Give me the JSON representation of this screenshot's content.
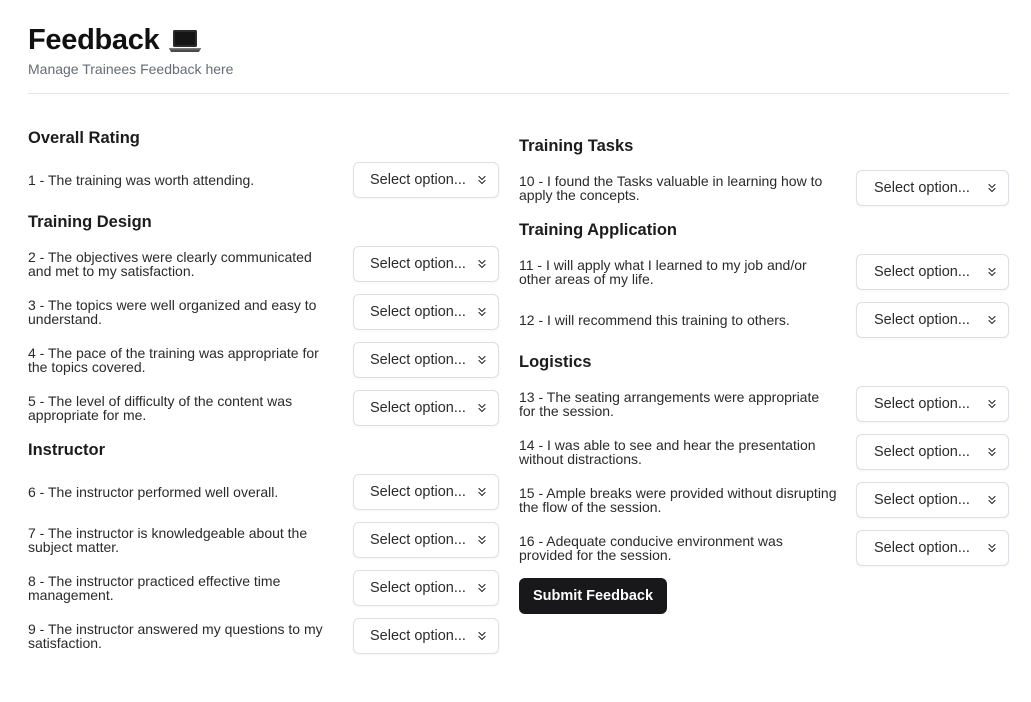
{
  "header": {
    "title": "Feedback",
    "icon": "laptop-icon",
    "subtitle": "Manage Trainees Feedback here"
  },
  "select_placeholder": "Select option...",
  "sections": {
    "overall": {
      "title": "Overall Rating",
      "questions": [
        "1 - The training was worth attending."
      ]
    },
    "design": {
      "title": "Training Design",
      "questions": [
        "2 - The objectives were clearly communicated and met to my satisfaction.",
        "3 - The topics were well organized and easy to understand.",
        "4 - The pace of the training was appropriate for the topics covered.",
        "5 - The level of difficulty of the content was appropriate for me."
      ]
    },
    "instructor": {
      "title": "Instructor",
      "questions": [
        "6 - The instructor performed well overall.",
        "7 - The instructor is knowledgeable about the subject matter.",
        "8 - The instructor practiced effective time management.",
        "9 - The instructor answered my questions to my satisfaction."
      ]
    },
    "tasks": {
      "title": "Training Tasks",
      "questions": [
        "10 - I found the Tasks valuable in learning how to apply the concepts."
      ]
    },
    "application": {
      "title": "Training Application",
      "questions": [
        "11 - I will apply what I learned to my job and/or other areas of my life.",
        "12 - I will recommend this training to others."
      ]
    },
    "logistics": {
      "title": "Logistics",
      "questions": [
        "13 - The seating arrangements were appropriate for the session.",
        "14 - I was able to see and hear the presentation without distractions.",
        "15 - Ample breaks were provided without disrupting the flow of the session.",
        "16 - Adequate conducive environment was provided for the session."
      ]
    }
  },
  "submit_label": "Submit Feedback",
  "colors": {
    "button_bg": "#18181b",
    "subtitle": "#666c75",
    "border": "#dcdfe3"
  }
}
